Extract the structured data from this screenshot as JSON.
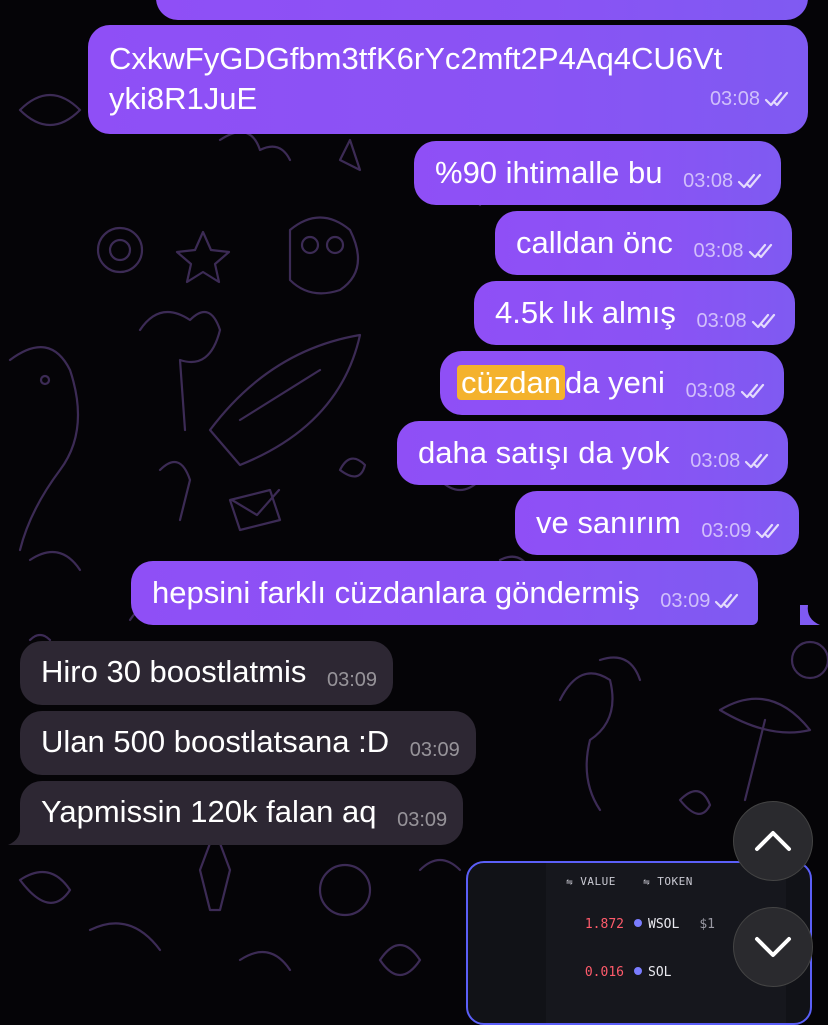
{
  "chat": {
    "messages": [
      {
        "direction": "outgoing",
        "text_lines": [
          "CxkwFyGDGfbm3tfK6rYc2mft2P4Aq4CU6Vt",
          "yki8R1JuE"
        ],
        "time": "03:08",
        "status": "read"
      },
      {
        "direction": "outgoing",
        "text": "%90 ihtimalle bu",
        "time": "03:08",
        "status": "read"
      },
      {
        "direction": "outgoing",
        "text": "calldan önc",
        "time": "03:08",
        "status": "read"
      },
      {
        "direction": "outgoing",
        "text": "4.5k lık almış",
        "time": "03:08",
        "status": "read"
      },
      {
        "direction": "outgoing",
        "highlight": "cüzdan",
        "text": "da yeni",
        "time": "03:08",
        "status": "read"
      },
      {
        "direction": "outgoing",
        "text": "daha satışı da yok",
        "time": "03:08",
        "status": "read"
      },
      {
        "direction": "outgoing",
        "text": "ve sanırım",
        "time": "03:09",
        "status": "read"
      },
      {
        "direction": "outgoing",
        "text": "hepsini farklı cüzdanlara göndermiş",
        "time": "03:09",
        "status": "read"
      },
      {
        "direction": "incoming",
        "text": "Hiro 30 boostlatmis",
        "time": "03:09"
      },
      {
        "direction": "incoming",
        "text": "Ulan 500 boostlatsana :D",
        "time": "03:09"
      },
      {
        "direction": "incoming",
        "text": "Yapmissin 120k falan aq",
        "time": "03:09"
      }
    ]
  },
  "photo_preview": {
    "headers": [
      "VALUE",
      "TOKEN"
    ],
    "rows": [
      {
        "value": "1.872",
        "token": "WSOL",
        "extra": "$1"
      },
      {
        "value": "0.016",
        "token": "SOL"
      }
    ]
  },
  "controls": {
    "scroll_up_icon": "chevron-up-icon",
    "scroll_down_icon": "chevron-down-icon"
  },
  "colors": {
    "outgoing_bubble": "#8a53f4",
    "incoming_bubble": "#2d2733",
    "highlight": "#f4b22c",
    "background": "#050407"
  }
}
